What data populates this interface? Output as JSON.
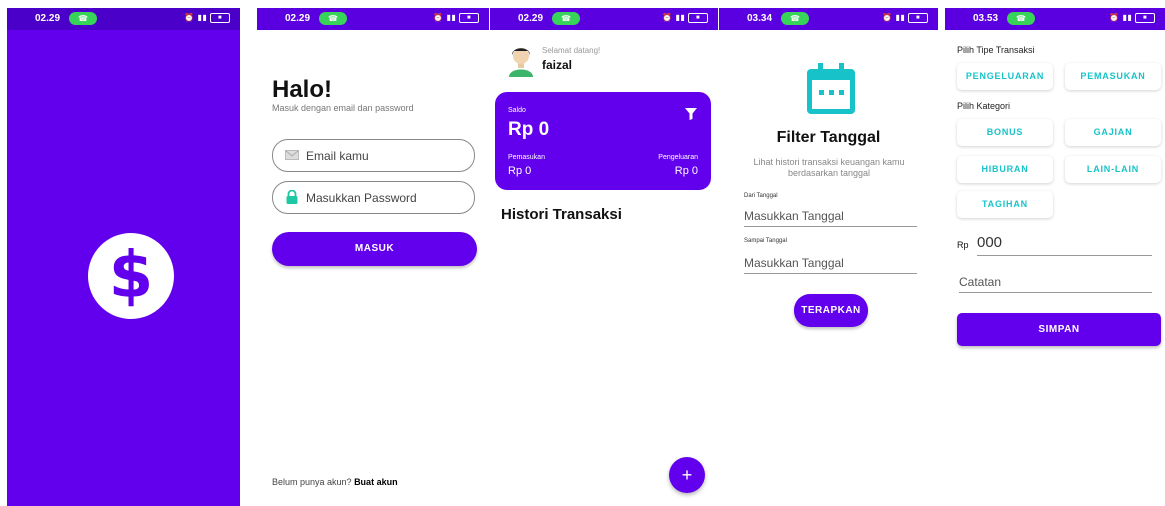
{
  "splash": {
    "time": "02.29",
    "logo_symbol": "$"
  },
  "login": {
    "time": "02.29",
    "title": "Halo!",
    "subtitle": "Masuk dengan email dan password",
    "email_placeholder": "Email kamu",
    "password_placeholder": "Masukkan Password",
    "login_button": "MASUK",
    "footer_prefix": "Belum punya akun? ",
    "footer_link": "Buat akun"
  },
  "home": {
    "time": "02.29",
    "welcome": "Selamat datang!",
    "username": "faizal",
    "balance_label": "Saldo",
    "balance_value": "Rp 0",
    "income_label": "Pemasukan",
    "income_value": "Rp 0",
    "expense_label": "Pengeluaran",
    "expense_value": "Rp 0",
    "history_title": "Histori Transaksi",
    "fab_symbol": "+"
  },
  "filter": {
    "time": "03.34",
    "title": "Filter Tanggal",
    "description": "Lihat histori transaksi keuangan kamu berdasarkan tanggal",
    "from_label": "Dari Tanggal",
    "from_placeholder": "Masukkan Tanggal",
    "to_label": "Sampai Tanggal",
    "to_placeholder": "Masukkan Tanggal",
    "apply_button": "TERAPKAN"
  },
  "add": {
    "time": "03.53",
    "type_label": "Pilih Tipe Transaksi",
    "type_expense": "PENGELUARAN",
    "type_income": "PEMASUKAN",
    "category_label": "Pilih Kategori",
    "categories": [
      "BONUS",
      "GAJIAN",
      "HIBURAN",
      "LAIN-LAIN",
      "TAGIHAN"
    ],
    "currency_prefix": "Rp",
    "amount_placeholder": "000",
    "note_placeholder": "Catatan",
    "save_button": "SIMPAN"
  },
  "colors": {
    "primary": "#6200ee",
    "accent": "#17c3c9",
    "pill": "#38d45a"
  }
}
